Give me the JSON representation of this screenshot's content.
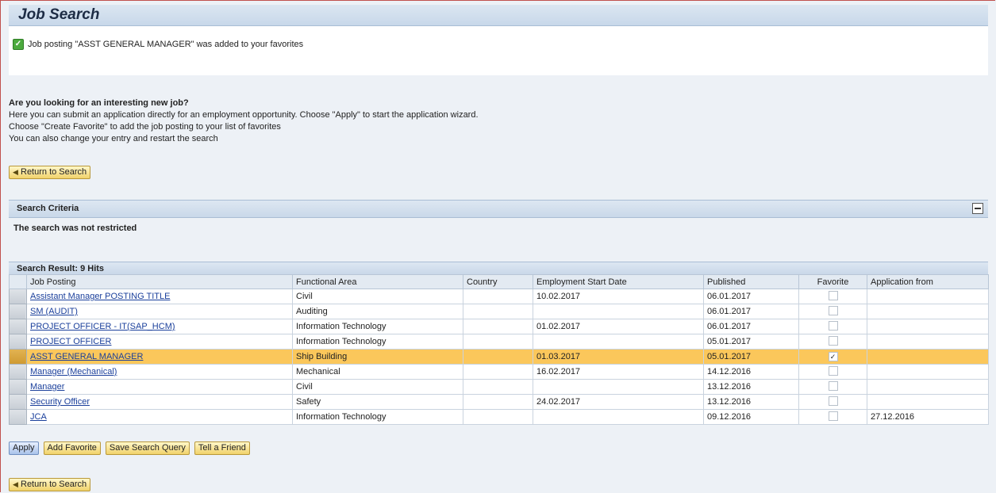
{
  "page_title": "Job Search",
  "message": "Job posting \"ASST GENERAL MANAGER\" was added to your favorites",
  "intro": {
    "heading": "Are you looking for an interesting new job?",
    "line1": "Here you can submit an application directly for an employment opportunity. Choose \"Apply\" to start the application wizard.",
    "line2": "Choose \"Create Favorite\" to add the job posting to your list of favorites",
    "line3": "You can also change your entry and restart the search"
  },
  "return_label": "Return to Search",
  "criteria": {
    "title": "Search Criteria",
    "text": "The search was not restricted"
  },
  "results": {
    "title": "Search Result: 9 Hits",
    "headers": [
      "Job Posting",
      "Functional Area",
      "Country",
      "Employment Start Date",
      "Published",
      "Favorite",
      "Application from"
    ],
    "rows": [
      {
        "job": "Assistant Manager POSTING TITLE",
        "area": "Civil",
        "country": "",
        "start": "10.02.2017",
        "published": "06.01.2017",
        "favorite": "",
        "app_from": ""
      },
      {
        "job": "SM (AUDIT)",
        "area": "Auditing",
        "country": "",
        "start": "",
        "published": "06.01.2017",
        "favorite": "",
        "app_from": ""
      },
      {
        "job": "PROJECT OFFICER - IT(SAP_HCM)",
        "area": "Information Technology",
        "country": "",
        "start": "01.02.2017",
        "published": "06.01.2017",
        "favorite": "",
        "app_from": ""
      },
      {
        "job": "PROJECT OFFICER",
        "area": "Information Technology",
        "country": "",
        "start": "",
        "published": "05.01.2017",
        "favorite": "",
        "app_from": ""
      },
      {
        "job": "ASST GENERAL MANAGER",
        "area": "Ship Building",
        "country": "",
        "start": "01.03.2017",
        "published": "05.01.2017",
        "favorite": "✓",
        "app_from": ""
      },
      {
        "job": "Manager (Mechanical)",
        "area": "Mechanical",
        "country": "",
        "start": "16.02.2017",
        "published": "14.12.2016",
        "favorite": "",
        "app_from": ""
      },
      {
        "job": "Manager",
        "area": "Civil",
        "country": "",
        "start": "",
        "published": "13.12.2016",
        "favorite": "",
        "app_from": ""
      },
      {
        "job": "Security Officer",
        "area": "Safety",
        "country": "",
        "start": "24.02.2017",
        "published": "13.12.2016",
        "favorite": "",
        "app_from": ""
      },
      {
        "job": "JCA",
        "area": "Information Technology",
        "country": "",
        "start": "",
        "published": "09.12.2016",
        "favorite": "",
        "app_from": "27.12.2016"
      }
    ]
  },
  "actions": {
    "apply": "Apply",
    "add_favorite": "Add Favorite",
    "save_query": "Save Search Query",
    "tell_friend": "Tell a Friend"
  }
}
